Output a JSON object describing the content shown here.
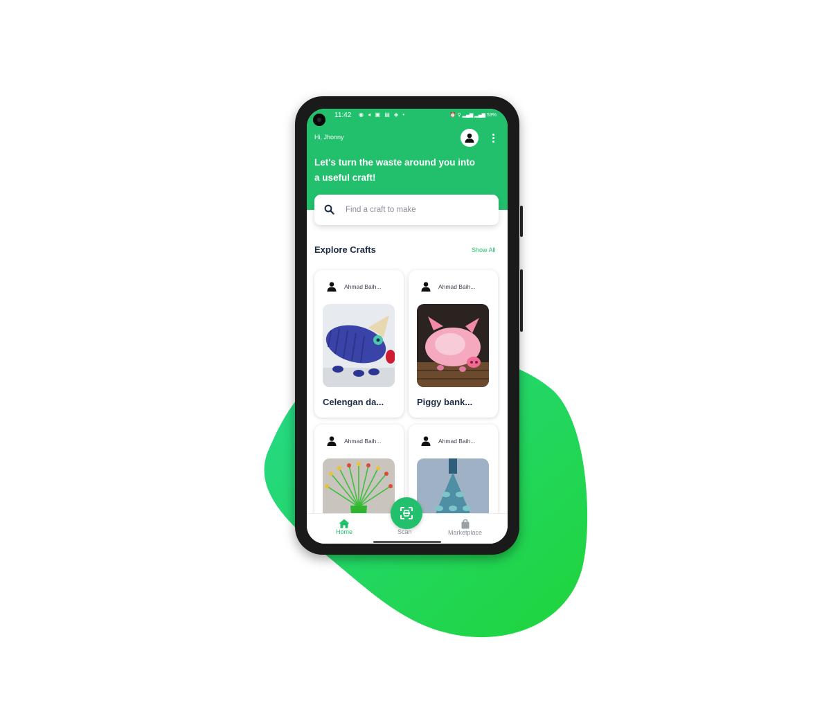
{
  "colors": {
    "primary": "#22c06d",
    "blob_start": "#27d98c",
    "blob_end": "#1fd43a",
    "text_dark": "#1d2a44"
  },
  "status_bar": {
    "time": "11:42",
    "notification_icons": "◉ ◂ ▣ ▤ ◈ •",
    "system_icons": "⏰ ⚲ ▂▄▆ ▂▄▆ 53%"
  },
  "header": {
    "greeting": "Hi, Jhonny",
    "headline": "Let's turn the waste around you into a useful craft!",
    "profile_icon": "person-icon",
    "menu_icon": "more-vertical-icon"
  },
  "search": {
    "placeholder": "Find a craft to make",
    "icon": "search-icon"
  },
  "explore": {
    "title": "Explore Crafts",
    "show_all": "Show All",
    "cards": [
      {
        "author": "Ahmad Baih...",
        "title": "Celengan da...",
        "image": "blue bottle pig"
      },
      {
        "author": "Ahmad Baih...",
        "title": "Piggy bank...",
        "image": "pink bottle piggy bank"
      },
      {
        "author": "Ahmad Baih...",
        "title": "",
        "image": "green bottle flower"
      },
      {
        "author": "Ahmad Baih...",
        "title": "",
        "image": "bottle chandelier"
      }
    ]
  },
  "bottom_nav": {
    "items": [
      {
        "label": "Home",
        "icon": "home-icon",
        "active": true
      },
      {
        "label": "Scan",
        "icon": "scan-icon",
        "active": false
      },
      {
        "label": "Marketplace",
        "icon": "shopping-bag-icon",
        "active": false
      }
    ]
  }
}
